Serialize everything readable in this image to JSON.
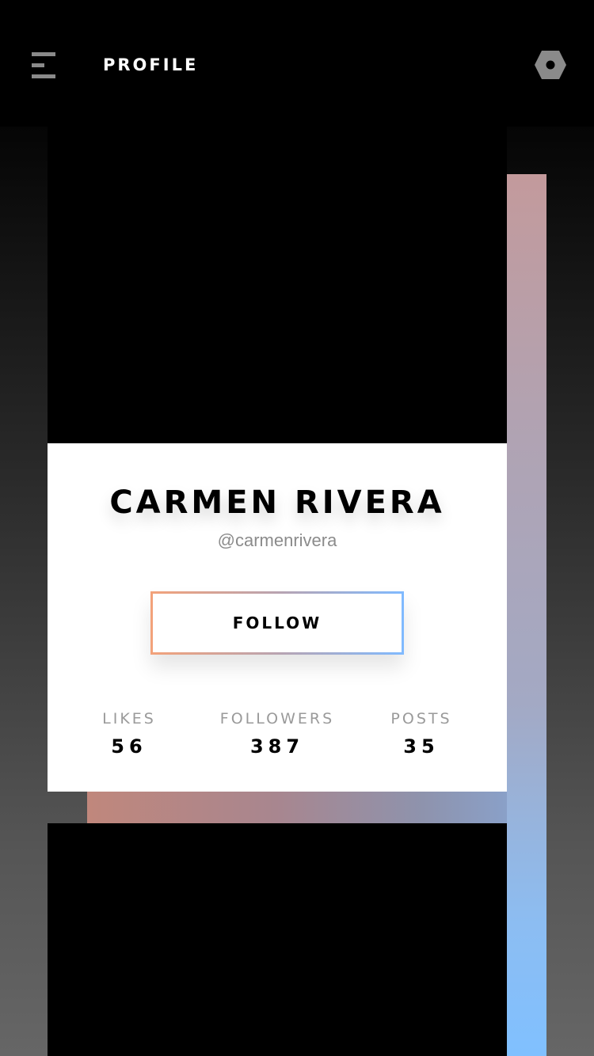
{
  "header": {
    "title": "PROFILE",
    "menu_icon": "menu-icon",
    "settings_icon": "hexagon-settings-icon"
  },
  "profile": {
    "name": "CARMEN RIVERA",
    "handle": "@carmenrivera",
    "follow_label": "FOLLOW"
  },
  "stats": [
    {
      "label": "LIKES",
      "value": "56"
    },
    {
      "label": "FOLLOWERS",
      "value": "387"
    },
    {
      "label": "POSTS",
      "value": "35"
    }
  ],
  "colors": {
    "background_top": "#000000",
    "background_bottom": "#666666",
    "accent_peach": "#f3a27a",
    "accent_blue": "#80baff",
    "card": "#ffffff"
  }
}
